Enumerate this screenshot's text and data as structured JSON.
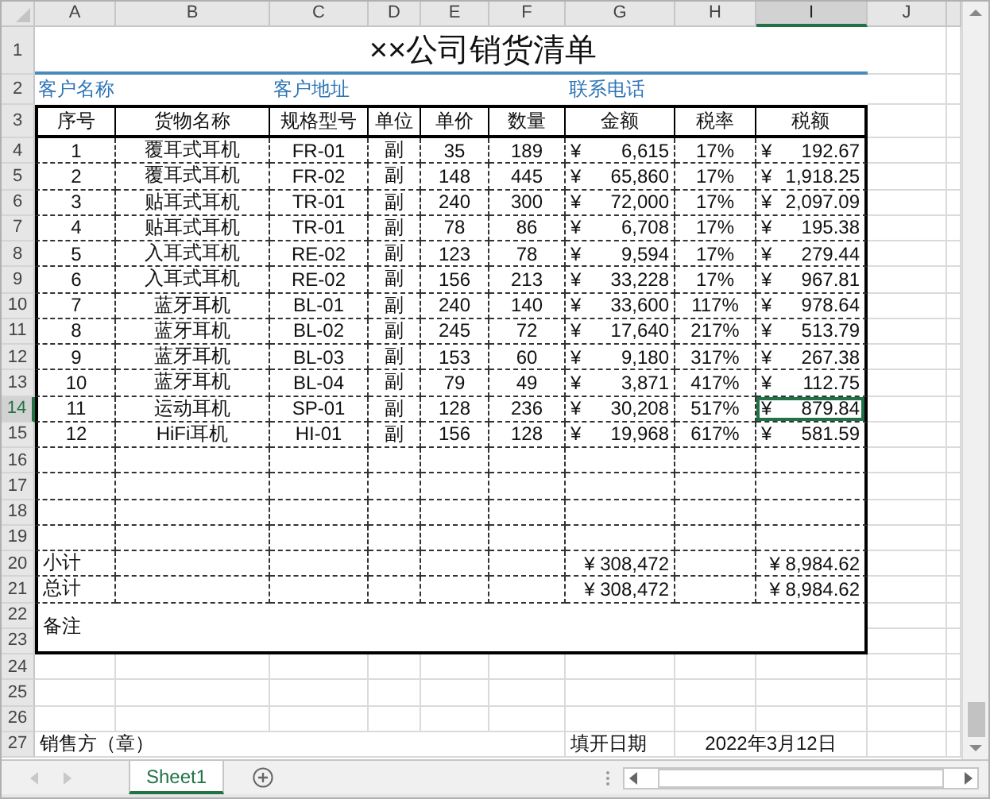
{
  "column_headers": [
    {
      "label": "A",
      "selected": false
    },
    {
      "label": "B",
      "selected": false
    },
    {
      "label": "C",
      "selected": false
    },
    {
      "label": "D",
      "selected": false
    },
    {
      "label": "E",
      "selected": false
    },
    {
      "label": "F",
      "selected": false
    },
    {
      "label": "G",
      "selected": false
    },
    {
      "label": "H",
      "selected": false
    },
    {
      "label": "I",
      "selected": true
    },
    {
      "label": "J",
      "selected": false
    }
  ],
  "row_headers": [
    {
      "label": "1",
      "selected": false
    },
    {
      "label": "2",
      "selected": false
    },
    {
      "label": "3",
      "selected": false
    },
    {
      "label": "4",
      "selected": false
    },
    {
      "label": "5",
      "selected": false
    },
    {
      "label": "6",
      "selected": false
    },
    {
      "label": "7",
      "selected": false
    },
    {
      "label": "8",
      "selected": false
    },
    {
      "label": "9",
      "selected": false
    },
    {
      "label": "10",
      "selected": false
    },
    {
      "label": "11",
      "selected": false
    },
    {
      "label": "12",
      "selected": false
    },
    {
      "label": "13",
      "selected": false
    },
    {
      "label": "14",
      "selected": true
    },
    {
      "label": "15",
      "selected": false
    },
    {
      "label": "16",
      "selected": false
    },
    {
      "label": "17",
      "selected": false
    },
    {
      "label": "18",
      "selected": false
    },
    {
      "label": "19",
      "selected": false
    },
    {
      "label": "20",
      "selected": false
    },
    {
      "label": "21",
      "selected": false
    },
    {
      "label": "22",
      "selected": false
    },
    {
      "label": "23",
      "selected": false
    },
    {
      "label": "24",
      "selected": false
    },
    {
      "label": "25",
      "selected": false
    },
    {
      "label": "26",
      "selected": false
    },
    {
      "label": "27",
      "selected": false
    }
  ],
  "title": "××公司销货清单",
  "info_labels": [
    "客户名称",
    "客户地址",
    "联系电话"
  ],
  "table": {
    "columns": [
      "序号",
      "货物名称",
      "规格型号",
      "单位",
      "单价",
      "数量",
      "金额",
      "税率",
      "税额"
    ],
    "rows": [
      {
        "no": "1",
        "name": "覆耳式耳机",
        "model": "FR-01",
        "unit": "副",
        "price": "35",
        "qty": "189",
        "amount": {
          "sign": "¥",
          "value": "6,615"
        },
        "rate": "17%",
        "tax": {
          "sign": "¥",
          "value": "192.67"
        },
        "selected": false
      },
      {
        "no": "2",
        "name": "覆耳式耳机",
        "model": "FR-02",
        "unit": "副",
        "price": "148",
        "qty": "445",
        "amount": {
          "sign": "¥",
          "value": "65,860"
        },
        "rate": "17%",
        "tax": {
          "sign": "¥",
          "value": "1,918.25"
        },
        "selected": false
      },
      {
        "no": "3",
        "name": "贴耳式耳机",
        "model": "TR-01",
        "unit": "副",
        "price": "240",
        "qty": "300",
        "amount": {
          "sign": "¥",
          "value": "72,000"
        },
        "rate": "17%",
        "tax": {
          "sign": "¥",
          "value": "2,097.09"
        },
        "selected": false
      },
      {
        "no": "4",
        "name": "贴耳式耳机",
        "model": "TR-01",
        "unit": "副",
        "price": "78",
        "qty": "86",
        "amount": {
          "sign": "¥",
          "value": "6,708"
        },
        "rate": "17%",
        "tax": {
          "sign": "¥",
          "value": "195.38"
        },
        "selected": false
      },
      {
        "no": "5",
        "name": "入耳式耳机",
        "model": "RE-02",
        "unit": "副",
        "price": "123",
        "qty": "78",
        "amount": {
          "sign": "¥",
          "value": "9,594"
        },
        "rate": "17%",
        "tax": {
          "sign": "¥",
          "value": "279.44"
        },
        "selected": false
      },
      {
        "no": "6",
        "name": "入耳式耳机",
        "model": "RE-02",
        "unit": "副",
        "price": "156",
        "qty": "213",
        "amount": {
          "sign": "¥",
          "value": "33,228"
        },
        "rate": "17%",
        "tax": {
          "sign": "¥",
          "value": "967.81"
        },
        "selected": false
      },
      {
        "no": "7",
        "name": "蓝牙耳机",
        "model": "BL-01",
        "unit": "副",
        "price": "240",
        "qty": "140",
        "amount": {
          "sign": "¥",
          "value": "33,600"
        },
        "rate": "117%",
        "tax": {
          "sign": "¥",
          "value": "978.64"
        },
        "selected": false
      },
      {
        "no": "8",
        "name": "蓝牙耳机",
        "model": "BL-02",
        "unit": "副",
        "price": "245",
        "qty": "72",
        "amount": {
          "sign": "¥",
          "value": "17,640"
        },
        "rate": "217%",
        "tax": {
          "sign": "¥",
          "value": "513.79"
        },
        "selected": false
      },
      {
        "no": "9",
        "name": "蓝牙耳机",
        "model": "BL-03",
        "unit": "副",
        "price": "153",
        "qty": "60",
        "amount": {
          "sign": "¥",
          "value": "9,180"
        },
        "rate": "317%",
        "tax": {
          "sign": "¥",
          "value": "267.38"
        },
        "selected": false
      },
      {
        "no": "10",
        "name": "蓝牙耳机",
        "model": "BL-04",
        "unit": "副",
        "price": "79",
        "qty": "49",
        "amount": {
          "sign": "¥",
          "value": "3,871"
        },
        "rate": "417%",
        "tax": {
          "sign": "¥",
          "value": "112.75"
        },
        "selected": false
      },
      {
        "no": "11",
        "name": "运动耳机",
        "model": "SP-01",
        "unit": "副",
        "price": "128",
        "qty": "236",
        "amount": {
          "sign": "¥",
          "value": "30,208"
        },
        "rate": "517%",
        "tax": {
          "sign": "¥",
          "value": "879.84"
        },
        "selected": true
      },
      {
        "no": "12",
        "name": "HiFi耳机",
        "model": "HI-01",
        "unit": "副",
        "price": "156",
        "qty": "128",
        "amount": {
          "sign": "¥",
          "value": "19,968"
        },
        "rate": "617%",
        "tax": {
          "sign": "¥",
          "value": "581.59"
        },
        "selected": false
      }
    ]
  },
  "subtotal": {
    "label": "小计",
    "amount": "¥ 308,472",
    "tax": "¥ 8,984.62"
  },
  "total": {
    "label": "总计",
    "amount": "¥ 308,472",
    "tax": "¥ 8,984.62"
  },
  "remark": "备注",
  "footer": {
    "seller": "销售方（章）",
    "date_label": "填开日期",
    "date": "2022年3月12日"
  },
  "sheet_tabs": [
    {
      "label": "Sheet1",
      "selected": true
    }
  ]
}
